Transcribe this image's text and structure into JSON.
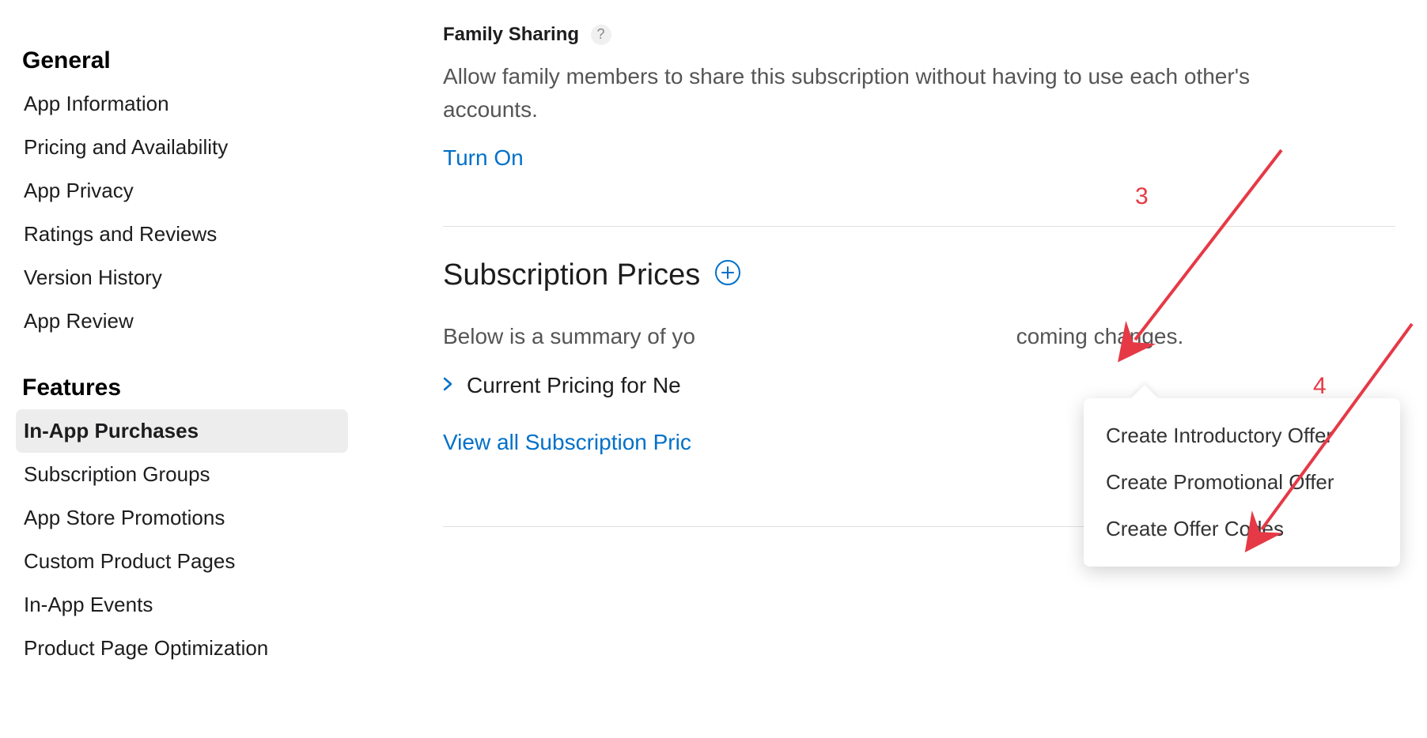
{
  "sidebar": {
    "heading_general": "General",
    "heading_features": "Features",
    "general_items": [
      "App Information",
      "Pricing and Availability",
      "App Privacy",
      "Ratings and Reviews",
      "Version History",
      "App Review"
    ],
    "feature_items": [
      "In-App Purchases",
      "Subscription Groups",
      "App Store Promotions",
      "Custom Product Pages",
      "In-App Events",
      "Product Page Optimization"
    ],
    "active_feature_index": 0
  },
  "family_sharing": {
    "title": "Family Sharing",
    "help": "?",
    "desc": "Allow family members to share this subscription without having to use each other's accounts.",
    "turn_on": "Turn On"
  },
  "subscription_prices": {
    "title": "Subscription Prices",
    "summary_prefix": "Below is a summary of yo",
    "summary_suffix": "coming changes.",
    "current_pricing": "Current Pricing for Ne",
    "view_all": "View all Subscription Pric"
  },
  "popover": {
    "items": [
      "Create Introductory Offer",
      "Create Promotional Offer",
      "Create Offer Codes"
    ]
  },
  "annotations": {
    "three": "3",
    "four": "4"
  }
}
